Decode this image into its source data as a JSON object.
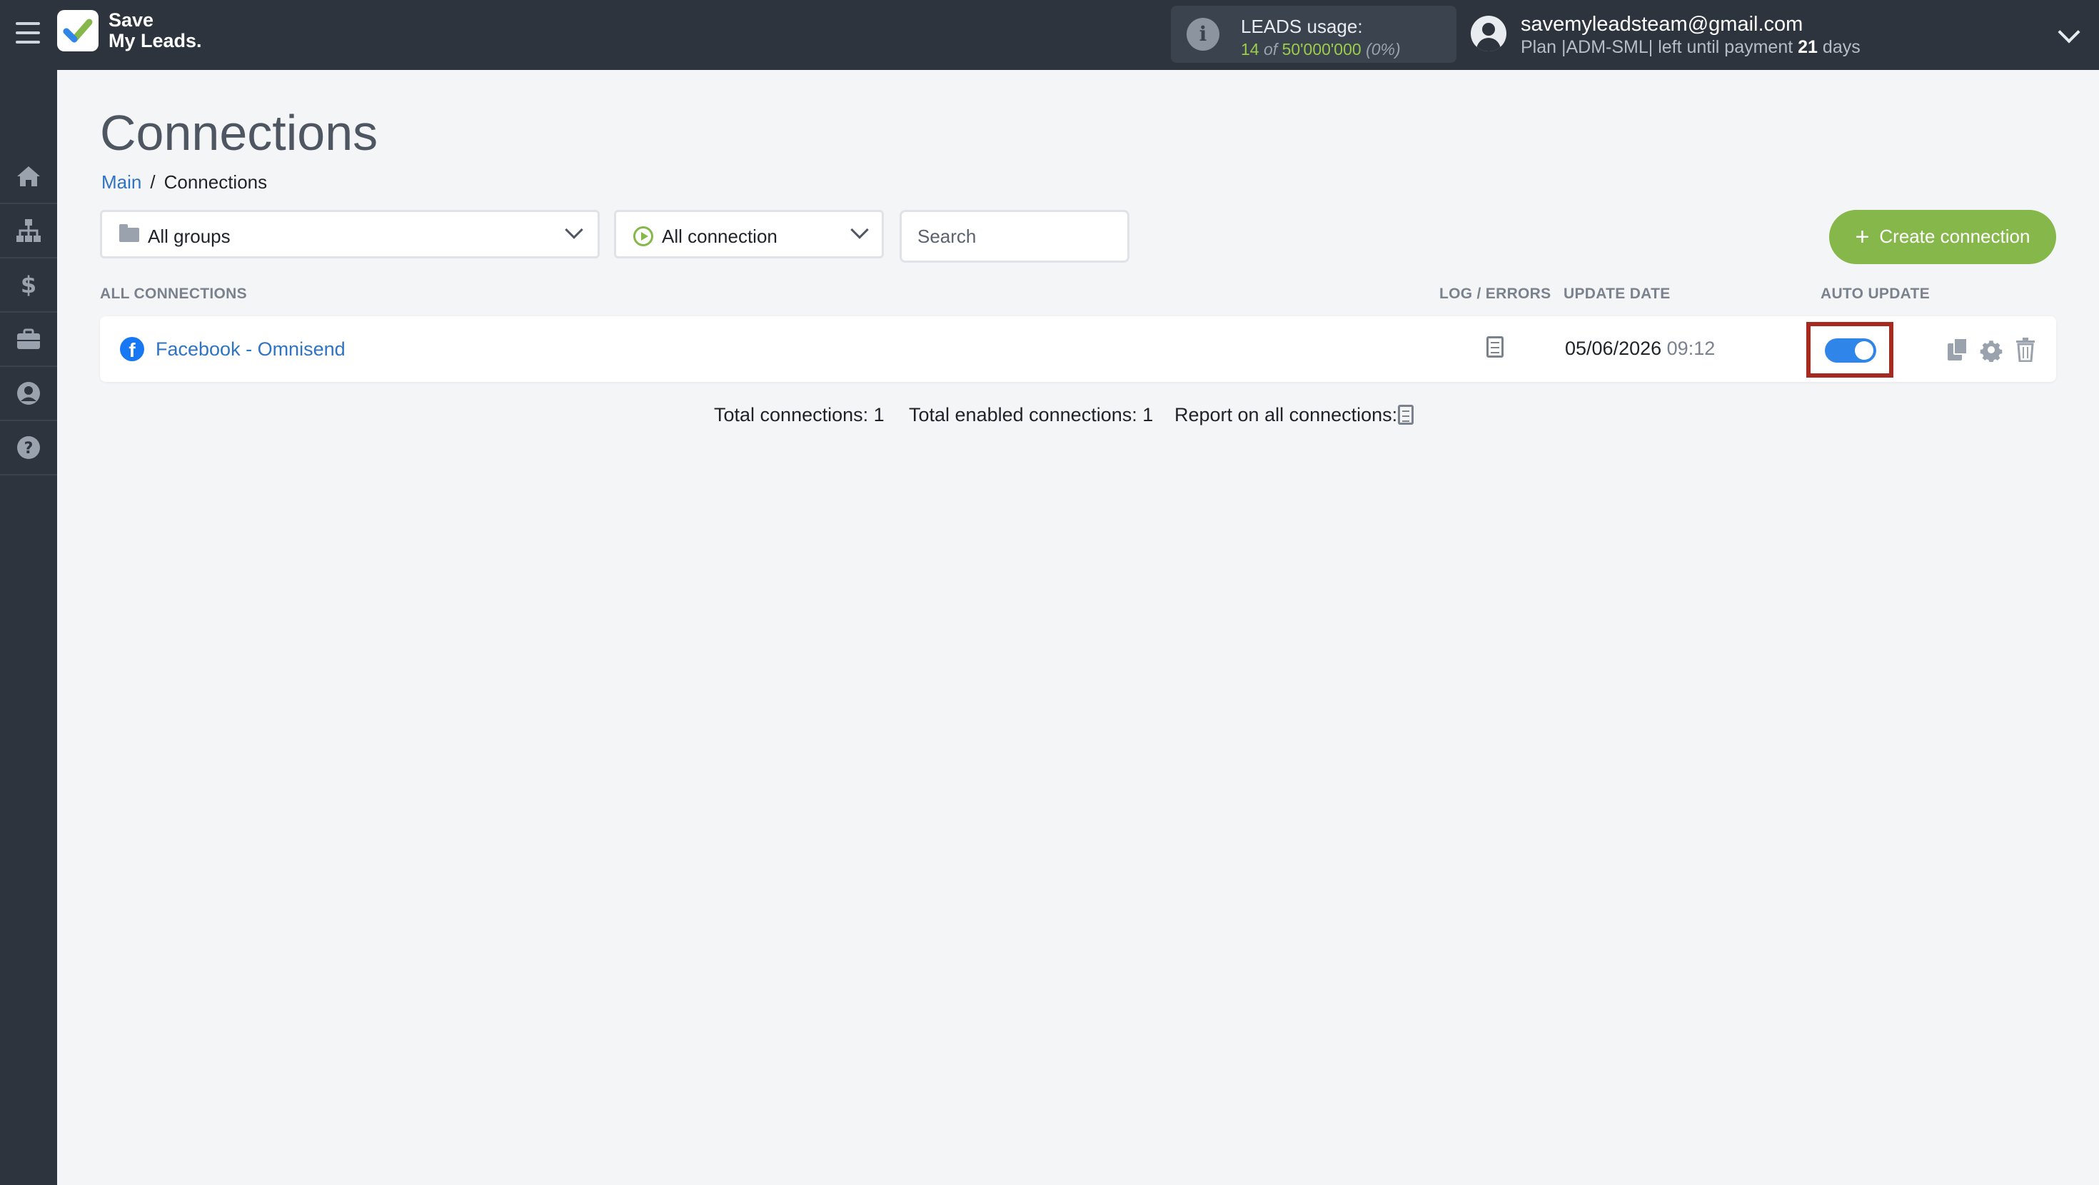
{
  "header": {
    "logo_line1": "Save",
    "logo_line2": "My Leads.",
    "leads_title": "LEADS usage:",
    "leads_used": "14",
    "leads_of": "of",
    "leads_total": "50'000'000",
    "leads_percent": "(0%)",
    "user_email": "savemyleadsteam@gmail.com",
    "plan_prefix": "Plan |ADM-SML| left until payment",
    "plan_days": "21",
    "plan_suffix": "days"
  },
  "sidebar": {
    "items": [
      {
        "icon": "home-icon"
      },
      {
        "icon": "sitemap-icon"
      },
      {
        "icon": "dollar-icon"
      },
      {
        "icon": "briefcase-icon"
      },
      {
        "icon": "user-circle-icon"
      },
      {
        "icon": "help-icon"
      }
    ]
  },
  "page": {
    "title": "Connections",
    "breadcrumb_main": "Main",
    "breadcrumb_sep": "/",
    "breadcrumb_current": "Connections"
  },
  "filters": {
    "groups_value": "All groups",
    "connection_value": "All connection",
    "search_placeholder": "Search",
    "create_label": "Create connection"
  },
  "table": {
    "headers": {
      "all": "ALL CONNECTIONS",
      "log": "LOG / ERRORS",
      "date": "UPDATE DATE",
      "auto": "AUTO UPDATE"
    },
    "rows": [
      {
        "name": "Facebook - Omnisend",
        "update_date": "05/06/2026",
        "update_time": "09:12",
        "auto_update": true
      }
    ]
  },
  "footer": {
    "total": "Total connections: 1",
    "enabled": "Total enabled connections: 1",
    "report": "Report on all connections:"
  },
  "colors": {
    "topbar": "#2d343e",
    "accent_green": "#86b74a",
    "link_blue": "#2f73c4",
    "toggle_blue": "#2f86e8",
    "highlight_red": "#a52b20"
  }
}
